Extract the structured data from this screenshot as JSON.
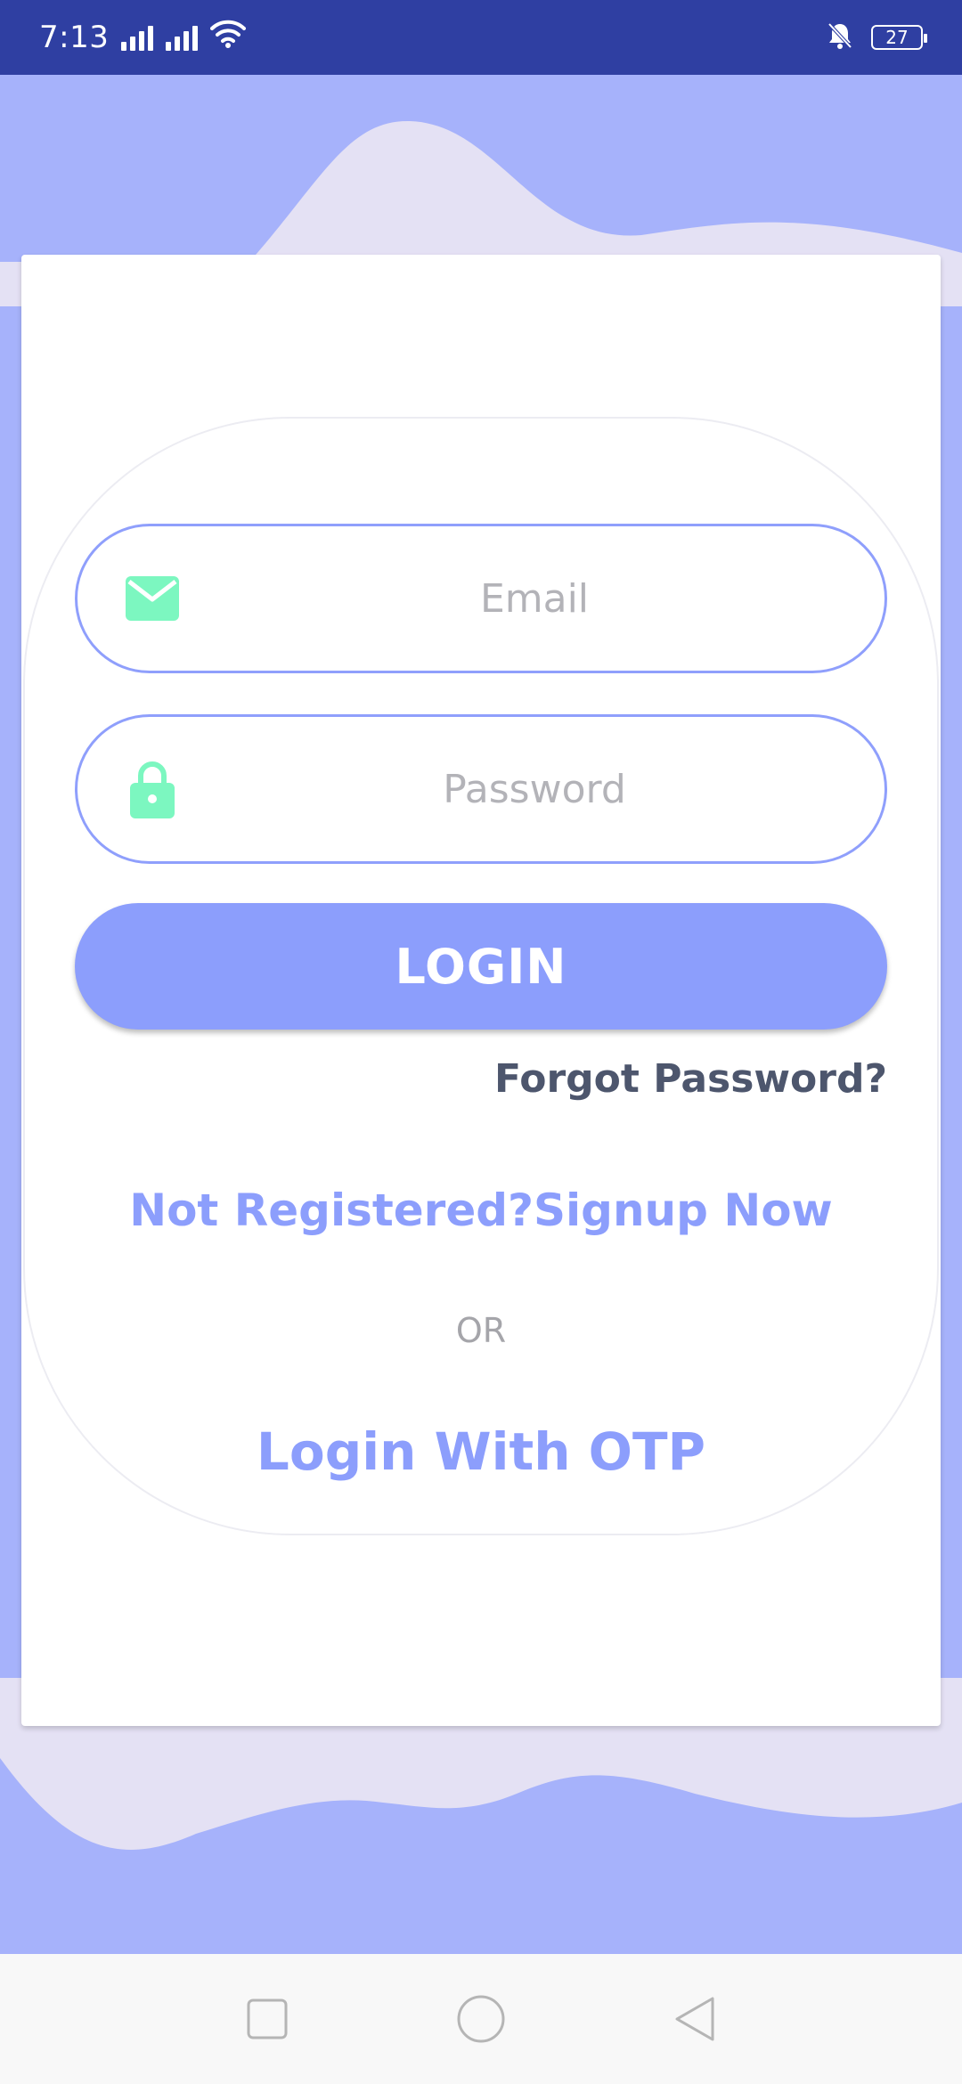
{
  "status_bar": {
    "time": "7:13",
    "battery_level": "27",
    "icons": [
      "signal-icon",
      "signal-icon",
      "wifi-icon",
      "bell-off-icon",
      "battery-icon"
    ]
  },
  "form": {
    "email": {
      "placeholder": "Email",
      "value": "",
      "icon": "mail-icon"
    },
    "password": {
      "placeholder": "Password",
      "value": "",
      "icon": "lock-icon"
    },
    "login_label": "LOGIN",
    "forgot_label": "Forgot Password?",
    "signup_label": "Not Registered?Signup Now",
    "or_label": "OR",
    "otp_label": "Login With OTP"
  },
  "nav": {
    "icons": [
      "recents-square-icon",
      "home-circle-icon",
      "back-triangle-icon"
    ]
  },
  "colors": {
    "status_bar": "#2f3fa2",
    "accent": "#8c9efc",
    "wave_dark": "#a6b2fb",
    "wave_light": "#e4e1f4",
    "icon_green": "#7cf7c0",
    "forgot_text": "#4d566d"
  }
}
